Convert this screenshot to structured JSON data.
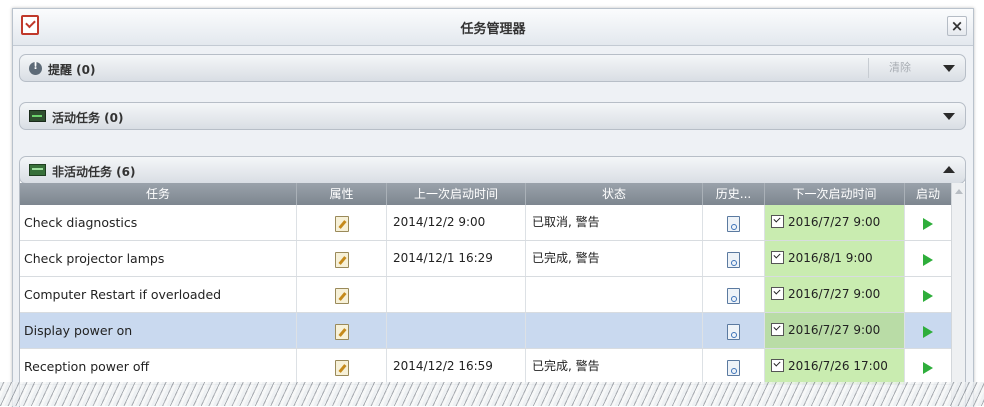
{
  "window": {
    "title": "任务管理器",
    "close_label": "×"
  },
  "sections": {
    "alerts": {
      "label": "提醒 (0)",
      "clear_label": "清除"
    },
    "active": {
      "label": "活动任务 (0)"
    },
    "inactive": {
      "label": "非活动任务 (6)"
    }
  },
  "table": {
    "columns": [
      "任务",
      "属性",
      "上一次启动时间",
      "状态",
      "历史...",
      "下一次启动时间",
      "启动"
    ],
    "rows": [
      {
        "name": "Check diagnostics",
        "last_start": "2014/12/2 9:00",
        "status": "已取消, 警告",
        "next_start": "2016/7/27 9:00",
        "selected": false
      },
      {
        "name": "Check projector lamps",
        "last_start": "2014/12/1 16:29",
        "status": "已完成, 警告",
        "next_start": "2016/8/1 9:00",
        "selected": false
      },
      {
        "name": "Computer Restart if overloaded",
        "last_start": "",
        "status": "",
        "next_start": "2016/7/27 9:00",
        "selected": false
      },
      {
        "name": "Display power on",
        "last_start": "",
        "status": "",
        "next_start": "2016/7/27 9:00",
        "selected": true
      },
      {
        "name": "Reception power off",
        "last_start": "2014/12/2 16:59",
        "status": "已完成, 警告",
        "next_start": "2016/7/26 17:00",
        "selected": false
      }
    ]
  },
  "colors": {
    "header_bg": "#858d96",
    "selected_row": "#c9d9ef",
    "next_start_bg": "#c9ecb0",
    "play": "#2eae3b"
  }
}
